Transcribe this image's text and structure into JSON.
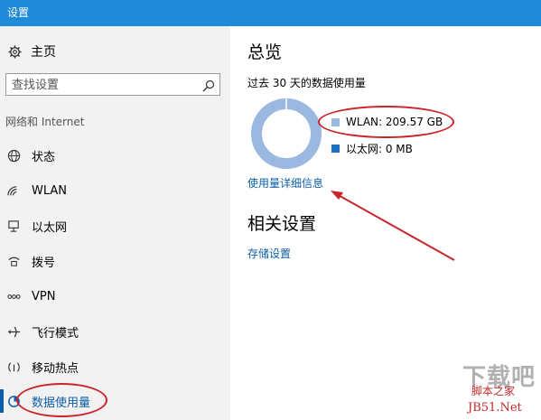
{
  "window": {
    "title": "设置"
  },
  "sidebar": {
    "home_label": "主页",
    "search_placeholder": "查找设置",
    "section_label": "网络和 Internet",
    "items": [
      {
        "label": "状态",
        "icon": "globe-icon"
      },
      {
        "label": "WLAN",
        "icon": "wifi-icon"
      },
      {
        "label": "以太网",
        "icon": "ethernet-icon"
      },
      {
        "label": "拨号",
        "icon": "dialup-icon"
      },
      {
        "label": "VPN",
        "icon": "vpn-icon"
      },
      {
        "label": "飞行模式",
        "icon": "airplane-icon"
      },
      {
        "label": "移动热点",
        "icon": "hotspot-icon"
      },
      {
        "label": "数据使用量",
        "icon": "data-usage-icon",
        "active": true
      }
    ]
  },
  "main": {
    "overview_title": "总览",
    "overview_subtitle": "过去 30 天的数据使用量",
    "legend": [
      {
        "label": "WLAN: 209.57 GB",
        "color": "#9bb9e0"
      },
      {
        "label": "以太网: 0 MB",
        "color": "#1e6fc4"
      }
    ],
    "usage_share": {
      "wlan": 1.0,
      "ethernet": 0.0
    },
    "usage_details_link": "使用量详细信息",
    "related_title": "相关设置",
    "storage_link": "存储设置"
  },
  "watermark": {
    "big": "下载吧",
    "line1": "脚本之家",
    "line2": "JB51.Net"
  },
  "colors": {
    "titlebar": "#1e8ad8",
    "accent": "#0d5ea8",
    "annotation": "#c8242a"
  }
}
